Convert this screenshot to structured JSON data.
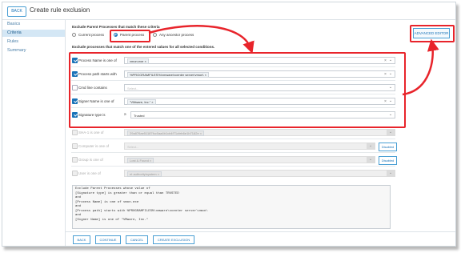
{
  "header": {
    "back_label": "BACK",
    "title": "Create rule exclusion"
  },
  "sidebar": {
    "items": [
      {
        "label": "Basics"
      },
      {
        "label": "Criteria"
      },
      {
        "label": "Rules"
      },
      {
        "label": "Summary"
      }
    ],
    "active_index": 1
  },
  "criteria": {
    "heading": "Exclude Parent Processes that match these criteria",
    "radio_options": [
      {
        "label": "Current process"
      },
      {
        "label": "Parent process"
      },
      {
        "label": "Any ancestor process"
      }
    ],
    "selected_radio": "Parent process",
    "subheading": "Exclude processes that match one of the entered values for all selected conditions.",
    "advanced_editor_label": "ADVANCED EDITOR"
  },
  "conditions": {
    "process_name": {
      "label": "Process Name is one of",
      "chip": "vmon.exe",
      "checked": true
    },
    "process_path": {
      "label": "Process path starts with",
      "chip": "%PROGRAMFILES%\\vmware\\vcenter server\\vmon\\",
      "checked": true
    },
    "cmd_line": {
      "label": "Cmd line contains",
      "placeholder": "Select...",
      "checked": false
    },
    "signer_name": {
      "label": "Signer Name is one of",
      "chip": "\"VMware, Inc.\"",
      "checked": true
    },
    "signature_type": {
      "label": "Signature type is",
      "operator": "≥",
      "value": "Trusted",
      "checked": true
    },
    "sha1": {
      "label": "SHA-1 is one of",
      "chip": "29a876ae51187fcc0aa4b1cb4f71cfeb6e1b7182e",
      "checked": false
    },
    "computer": {
      "label": "Computer is one of",
      "placeholder": "Select...",
      "button": "Disabled",
      "checked": false
    },
    "group": {
      "label": "Group is one of",
      "chip": "Lost & Found",
      "button": "Disabled",
      "checked": false
    },
    "user": {
      "label": "User is one of",
      "chip": "nt authority\\system",
      "checked": false
    }
  },
  "query_lines": [
    "Exclude Parent Processes whose value of",
    "[Signature type] is greater than or equal than TRUSTED",
    "and",
    "[Process Name] is one of vmon.exe",
    "and",
    "[Process path] starts with %PROGRAMFILES%\\vmware\\vcenter server\\vmon\\",
    "and",
    "[Signer Name] is one of \"VMware, Inc.\""
  ],
  "footer": {
    "back": "BACK",
    "continue": "CONTINUE",
    "cancel": "CANCEL",
    "create": "CREATE EXCLUSION"
  },
  "colors": {
    "accent": "#1a73b8",
    "highlight_red": "#e8242b",
    "active_nav_bg": "#d4e7f5"
  }
}
